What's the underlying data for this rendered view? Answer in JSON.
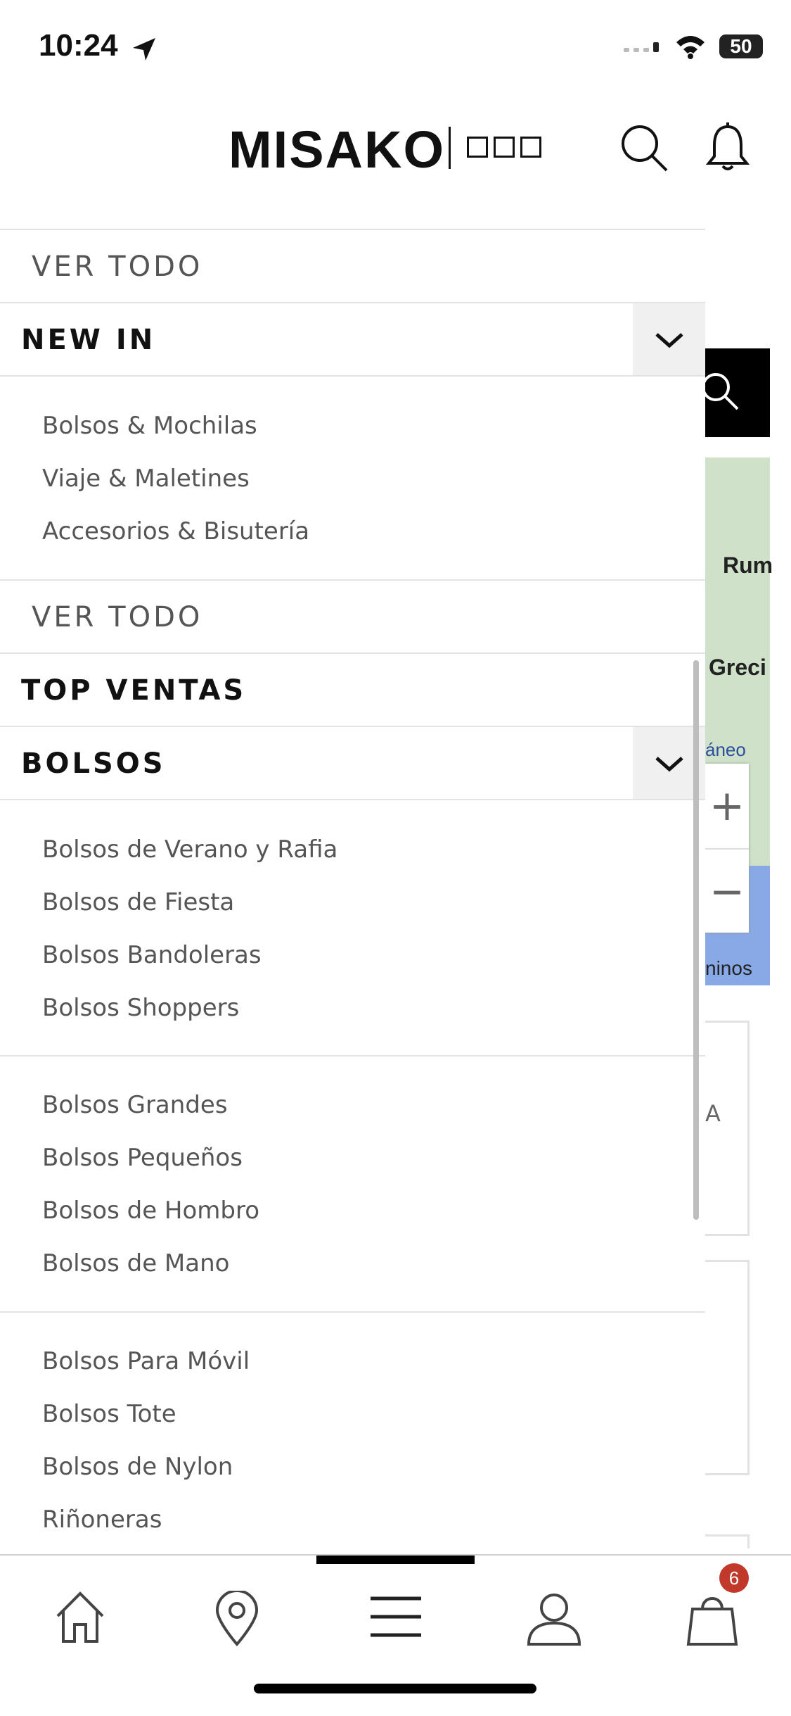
{
  "status_bar": {
    "time": "10:24",
    "battery": "50"
  },
  "header": {
    "logo": "MISAKO"
  },
  "menu": {
    "ver_todo_top": "VER TODO",
    "new_in": {
      "title": "NEW IN",
      "items": [
        "Bolsos & Mochilas",
        "Viaje & Maletines",
        "Accesorios & Bisutería"
      ],
      "ver_todo": "VER TODO"
    },
    "top_ventas": "TOP VENTAS",
    "bolsos": {
      "title": "BOLSOS",
      "group1": [
        "Bolsos de Verano y Rafia",
        "Bolsos de Fiesta",
        "Bolsos Bandoleras",
        "Bolsos Shoppers"
      ],
      "group2": [
        "Bolsos Grandes",
        "Bolsos Pequeños",
        "Bolsos de Hombro",
        "Bolsos de Mano"
      ],
      "group3": [
        "Bolsos Para Móvil",
        "Bolsos Tote",
        "Bolsos de Nylon",
        "Riñoneras"
      ]
    }
  },
  "background_map": {
    "labels": [
      "Rum",
      "Greci",
      "áneo",
      "ninos"
    ],
    "zoom_in": "+",
    "zoom_out": "−",
    "card_letter": "A"
  },
  "bottom_nav": {
    "cart_badge": "6"
  }
}
